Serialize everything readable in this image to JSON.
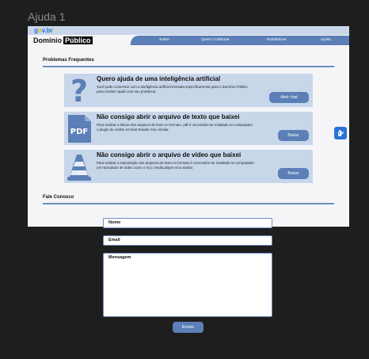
{
  "frame_label": "Ajuda 1",
  "header": {
    "gov_logo": {
      "p1": "g",
      "p2": "o",
      "p3": "v.b",
      "p4": "r"
    },
    "brand_text": "Domínio",
    "brand_highlight": "Público",
    "nav": [
      "Sobre",
      "Quero Colaborar",
      "Estatísticas",
      "Ajuda"
    ]
  },
  "faq": {
    "title": "Problemas Frequentes",
    "cards": [
      {
        "icon": "question-icon",
        "title": "Quero ajuda de uma inteligência artificial",
        "description": "Você pode conversar com a inteligência artificial treinada especificamente para o Domínio Público para receber ajuda com seu problema.",
        "button": "Abrir chat"
      },
      {
        "icon": "pdf-icon",
        "icon_text": "PDF",
        "title": "Não consigo abrir o arquivo de texto que baixei",
        "description": "Para realizar a leitura dos arquivos de texto no formato .pdf é necessário ter instalado no computador o plugin do Adobe Acrobat Reader e/ou similar.",
        "button": "Baixar"
      },
      {
        "icon": "vlc-cone-icon",
        "title": "Não consigo abrir o arquivo de vídeo que baixei",
        "description": "Para realizar a reprodução dos arquivos de texto no formato é necessário ter instalado no computador um reprodutor de vídeo como o VLC media player e/ou similar.",
        "button": "Baixar"
      }
    ]
  },
  "contact": {
    "title": "Fale Conosco",
    "name_label": "Nome",
    "email_label": "Email",
    "message_label": "Mensagem",
    "send_button": "Enviar"
  },
  "accessibility_button_icon": "sign-language-icon",
  "colors": {
    "accent": "#5b7fb6",
    "card_bg": "#c8d6ea",
    "topbar": "#c9d6ea",
    "side_button": "#2a73d9"
  }
}
